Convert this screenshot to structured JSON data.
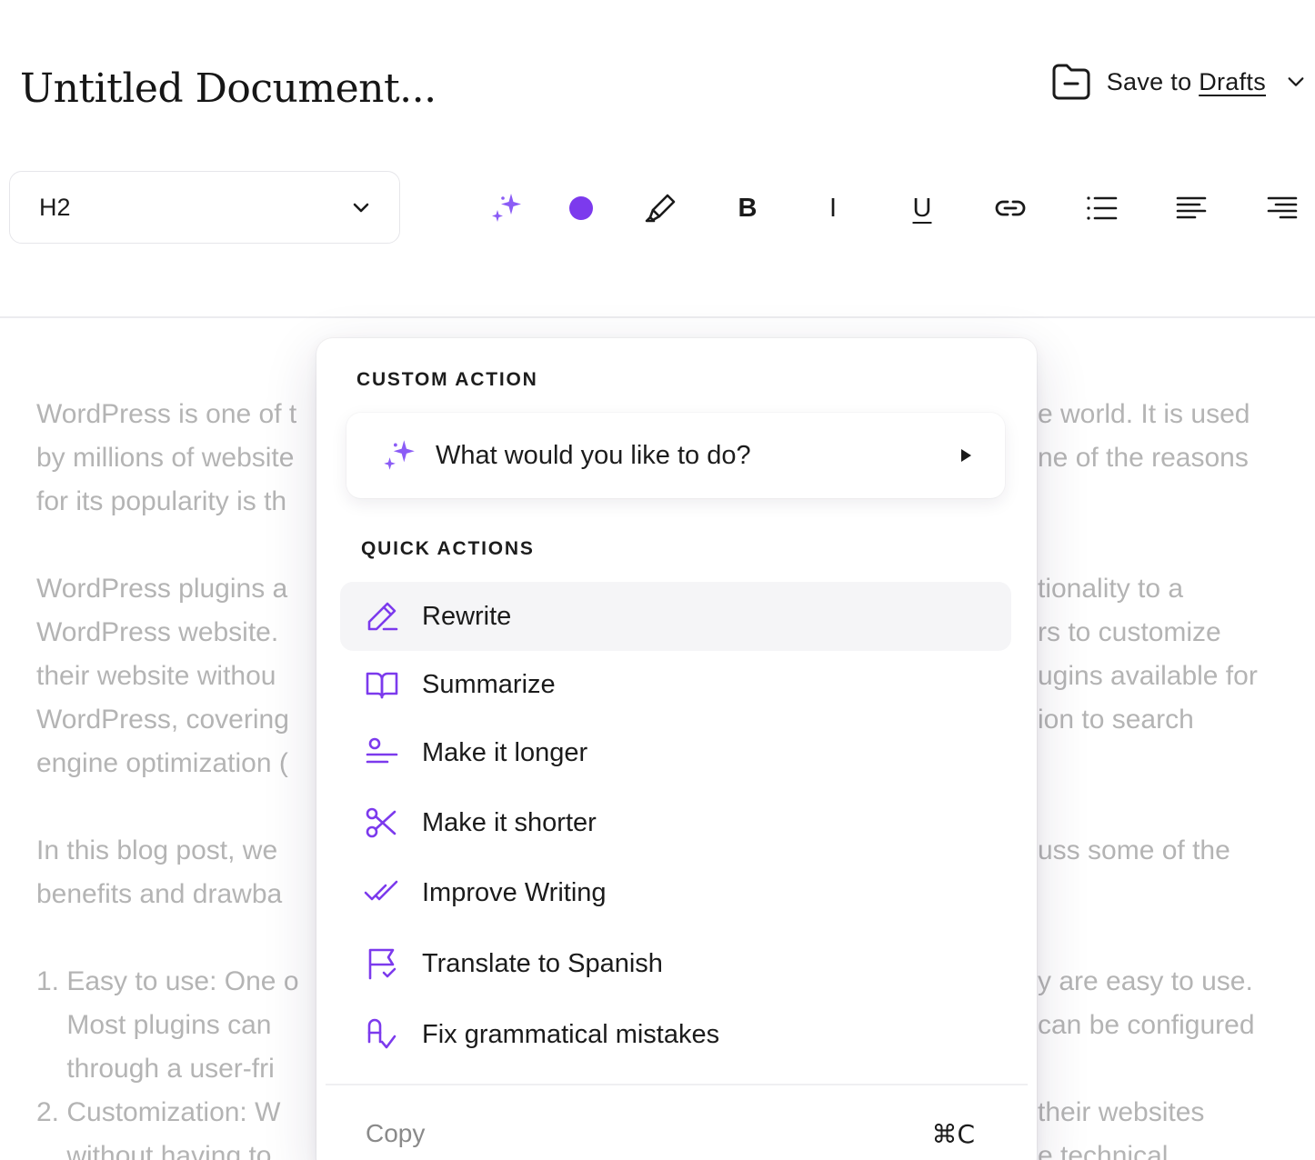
{
  "document": {
    "title": "Untitled Document..."
  },
  "save": {
    "prefix": "Save to ",
    "target": "Drafts"
  },
  "toolbar": {
    "heading_value": "H2",
    "bold_glyph": "B",
    "italic_glyph": "I",
    "underline_glyph": "U",
    "accent_color": "#7c3aed",
    "text_color_swatch": "#7c3aed"
  },
  "editor": {
    "left_lines": [
      "WordPress is one of t",
      "by millions of website",
      "for its popularity is th",
      "",
      "WordPress plugins a",
      "WordPress website.",
      "their website withou",
      "WordPress, covering",
      "engine optimization (",
      "",
      "In this blog post, we",
      "benefits and drawba",
      "",
      "1. Easy to use: One o",
      "    Most plugins can",
      "    through a user-fri",
      "2. Customization: W",
      "    without having to"
    ],
    "right_lines": [
      "e world. It is used",
      "ne of the reasons",
      "",
      "",
      "tionality to a",
      "rs to customize",
      "ugins available for",
      "ion to search",
      "",
      "",
      "uss some of the",
      "",
      "",
      "y are easy to use.",
      "can be configured",
      "",
      "their websites",
      "e technical"
    ]
  },
  "ai_menu": {
    "custom_section": "CUSTOM ACTION",
    "custom_placeholder": "What would you like to do?",
    "quick_section": "QUICK ACTIONS",
    "actions": [
      {
        "label": "Rewrite",
        "icon": "pencil-icon"
      },
      {
        "label": "Summarize",
        "icon": "book-open-icon"
      },
      {
        "label": "Make it longer",
        "icon": "expand-text-icon"
      },
      {
        "label": "Make it shorter",
        "icon": "scissors-icon"
      },
      {
        "label": "Improve Writing",
        "icon": "double-check-icon"
      },
      {
        "label": "Translate to Spanish",
        "icon": "flag-icon"
      },
      {
        "label": "Fix grammatical mistakes",
        "icon": "spell-check-icon"
      }
    ],
    "copy_label": "Copy",
    "copy_shortcut": "⌘C"
  }
}
